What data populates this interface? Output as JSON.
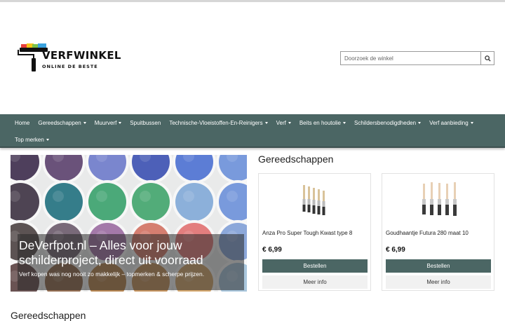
{
  "brand": {
    "name": "VERFWINKEL",
    "tagline": "ONLINE DE BESTE",
    "colors": {
      "primary": "#4b6664",
      "accent_red": "#e8403c",
      "accent_blue": "#3aa3df",
      "accent_green": "#7cc24a",
      "accent_yellow": "#f5c518"
    }
  },
  "search": {
    "placeholder": "Doorzoek de winkel",
    "icon": "search-icon"
  },
  "nav": {
    "row1": [
      {
        "label": "Home",
        "dropdown": false
      },
      {
        "label": "Gereedschappen",
        "dropdown": true
      },
      {
        "label": "Muurverf",
        "dropdown": true
      },
      {
        "label": "Spuitbussen",
        "dropdown": false
      },
      {
        "label": "Technische-Vloeistoffen-En-Reinigers",
        "dropdown": true
      },
      {
        "label": "Verf",
        "dropdown": true
      },
      {
        "label": "Beits en houtolie",
        "dropdown": true
      },
      {
        "label": "Schildersbenodigdheden",
        "dropdown": true
      },
      {
        "label": "Verf aanbieding",
        "dropdown": true
      }
    ],
    "row2": [
      {
        "label": "Top merken",
        "dropdown": true
      }
    ]
  },
  "hero": {
    "title_line1": "DeVerfpot.nl – Alles voor jouw",
    "title_line2": "schilderproject, direct uit voorraad",
    "subtitle": "Verf kopen was nog nooit zo makkelijk – topmerken & scherpe prijzen."
  },
  "section": {
    "title": "Gereedschappen"
  },
  "products": [
    {
      "name": "Anza Pro Super Tough Kwast type 8",
      "price": "€ 6,99",
      "order_label": "Bestellen",
      "info_label": "Meer info"
    },
    {
      "name": "Goudhaantje Futura 280 maat 10",
      "price": "€ 6,99",
      "order_label": "Bestellen",
      "info_label": "Meer info"
    }
  ],
  "bottom": {
    "heading": "Gereedschappen"
  }
}
